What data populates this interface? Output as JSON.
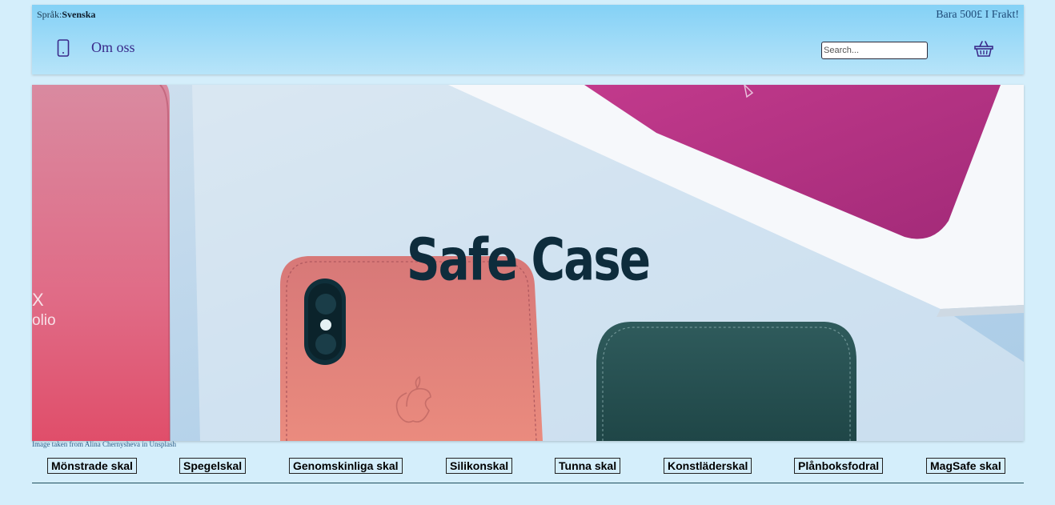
{
  "header": {
    "language_label": "Språk:",
    "language_value": "Svenska",
    "promo": "Bara 500£ I Frakt!",
    "about_link": "Om oss",
    "search_placeholder": "Search...",
    "phone_icon": "phone-icon",
    "basket_icon": "basket-icon"
  },
  "hero": {
    "title": "Safe Case",
    "credit": "Image taken from Alina Chernysheva in Unsplash",
    "box_text_line1": "X",
    "box_text_line2": "olio"
  },
  "categories": [
    "Mönstrade skal",
    "Spegelskal",
    "Genomskinliga skal",
    "Silikonskal",
    "Tunna skal",
    "Konstläderskal",
    "Plånboksfodral",
    "MagSafe skal"
  ],
  "colors": {
    "page_background": "#d4eefb",
    "header_gradient_top": "#84d1f6",
    "header_gradient_bottom": "#b7e4f9",
    "hero_title": "#0e2c3c",
    "link": "#3a2a8a"
  }
}
